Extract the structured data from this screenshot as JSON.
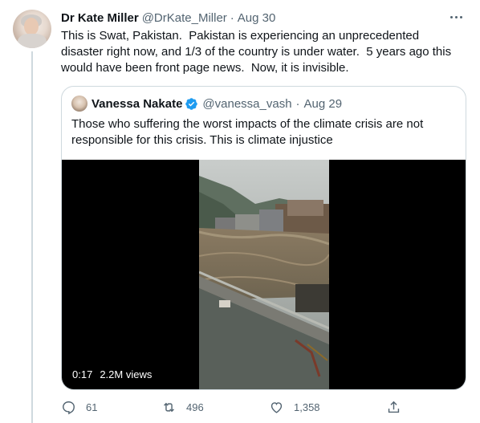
{
  "tweet": {
    "author_name": "Dr Kate Miller",
    "author_handle": "@DrKate_Miller",
    "dot": "·",
    "time": "Aug 30",
    "text": "This is Swat, Pakistan.  Pakistan is experiencing an unprecedented disaster right now, and 1/3 of the country is under water.  5 years ago this would have been front page news.  Now, it is invisible."
  },
  "quoted": {
    "author_name": "Vanessa Nakate",
    "author_handle": "@vanessa_vash",
    "dot": "·",
    "time": "Aug 29",
    "text": "Those who suffering the worst impacts of the climate crisis are not responsible for this crisis. This is climate injustice",
    "video": {
      "duration": "0:17",
      "views": "2.2M views"
    }
  },
  "actions": {
    "replies": "61",
    "retweets": "496",
    "likes": "1,358"
  },
  "icons": {
    "more": "more-horizontal-icon",
    "verified": "verified-badge-icon",
    "reply": "reply-icon",
    "retweet": "retweet-icon",
    "like": "heart-icon",
    "share": "share-icon"
  },
  "colors": {
    "text": "#0f1419",
    "secondary": "#536471",
    "border": "#cfd9de",
    "verified": "#1d9bf0"
  }
}
